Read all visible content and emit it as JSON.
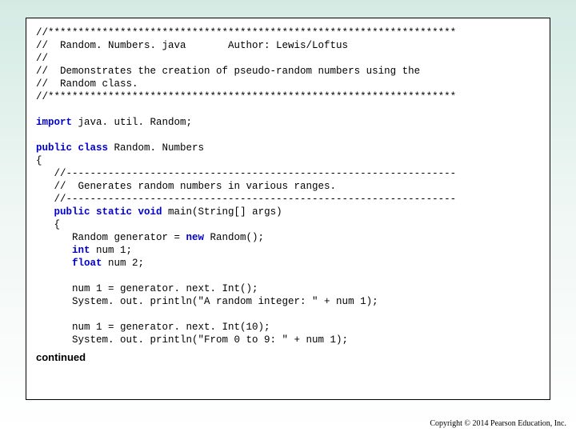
{
  "code": {
    "stars_top": "//********************************************************************",
    "l2": "//  Random. Numbers. java       Author: Lewis/Loftus",
    "l3": "//",
    "l4": "//  Demonstrates the creation of pseudo-random numbers using the",
    "l5": "//  Random class.",
    "stars_bot": "//********************************************************************",
    "imp1": "import",
    "imp2": " java. util. Random;",
    "pub": "public",
    "cls": " class",
    "clsname": " Random. Numbers",
    "lb": "{",
    "dash1": "   //-----------------------------------------------------------------",
    "cmt": "   //  Generates random numbers in various ranges.",
    "dash2": "   //-----------------------------------------------------------------",
    "ms1": "   public",
    "ms2": " static",
    "ms3": " void",
    "ms4": " main(String[] args)",
    "lb2": "   {",
    "r1": "      Random generator = ",
    "new": "new",
    "r2": " Random();",
    "int": "      int",
    "num1d": " num 1;",
    "float": "      float",
    "num2d": " num 2;",
    "s1": "      num 1 = generator. next. Int();",
    "s2": "      System. out. println(\"A random integer: \" + num 1);",
    "s3": "      num 1 = generator. next. Int(10);",
    "s4": "      System. out. println(\"From 0 to 9: \" + num 1);"
  },
  "continued": "continued",
  "copyright": "Copyright © 2014 Pearson Education, Inc."
}
